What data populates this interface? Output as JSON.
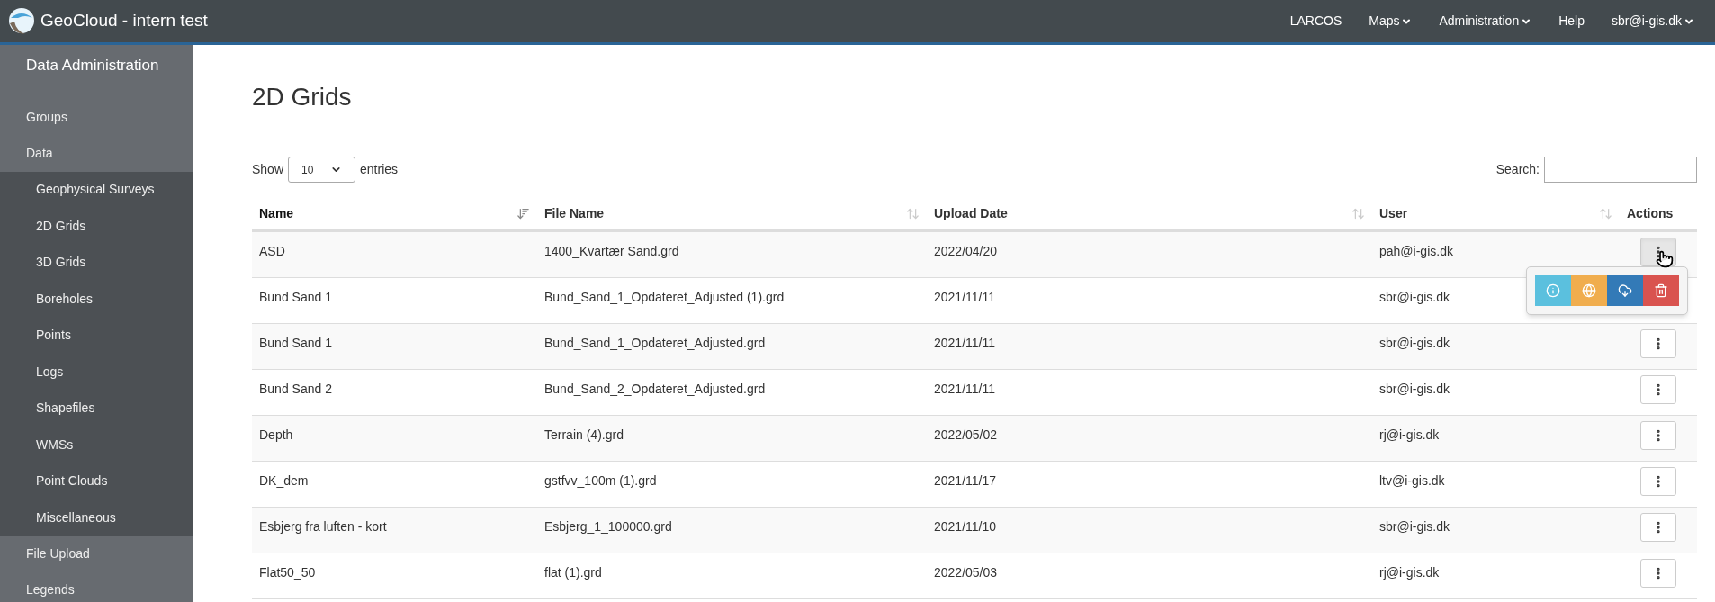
{
  "navbar": {
    "brand": "GeoCloud - intern test",
    "items": [
      {
        "label": "LARCOS",
        "dropdown": false
      },
      {
        "label": "Maps",
        "dropdown": true
      },
      {
        "label": "Administration",
        "dropdown": true
      },
      {
        "label": "Help",
        "dropdown": false
      },
      {
        "label": "sbr@i-gis.dk",
        "dropdown": true
      }
    ]
  },
  "sidebar": {
    "title": "Data Administration",
    "items": [
      {
        "label": "Groups"
      },
      {
        "label": "Data",
        "children": [
          {
            "label": "Geophysical Surveys"
          },
          {
            "label": "2D Grids"
          },
          {
            "label": "3D Grids"
          },
          {
            "label": "Boreholes"
          },
          {
            "label": "Points"
          },
          {
            "label": "Logs"
          },
          {
            "label": "Shapefiles"
          },
          {
            "label": "WMSs"
          },
          {
            "label": "Point Clouds"
          },
          {
            "label": "Miscellaneous"
          }
        ]
      },
      {
        "label": "File Upload"
      },
      {
        "label": "Legends"
      }
    ]
  },
  "page": {
    "title": "2D Grids"
  },
  "length_menu": {
    "before": "Show",
    "value": "10",
    "after": "entries"
  },
  "search": {
    "label": "Search:"
  },
  "table": {
    "columns": [
      {
        "label": "Name",
        "sorted": true
      },
      {
        "label": "File Name",
        "sorted": false
      },
      {
        "label": "Upload Date",
        "sorted": false
      },
      {
        "label": "User",
        "sorted": false
      },
      {
        "label": "Actions"
      }
    ],
    "rows": [
      {
        "cells": [
          "ASD",
          "1400_Kvartær Sand.grd",
          "2022/04/20",
          "pah@i-gis.dk"
        ],
        "menu_open": true
      },
      {
        "cells": [
          "Bund Sand 1",
          "Bund_Sand_1_Opdateret_Adjusted (1).grd",
          "2021/11/11",
          "sbr@i-gis.dk"
        ],
        "menu_open": false
      },
      {
        "cells": [
          "Bund Sand 1",
          "Bund_Sand_1_Opdateret_Adjusted.grd",
          "2021/11/11",
          "sbr@i-gis.dk"
        ],
        "menu_open": false
      },
      {
        "cells": [
          "Bund Sand 2",
          "Bund_Sand_2_Opdateret_Adjusted.grd",
          "2021/11/11",
          "sbr@i-gis.dk"
        ],
        "menu_open": false
      },
      {
        "cells": [
          "Depth",
          "Terrain (4).grd",
          "2022/05/02",
          "rj@i-gis.dk"
        ],
        "menu_open": false
      },
      {
        "cells": [
          "DK_dem",
          "gstfvv_100m (1).grd",
          "2021/11/17",
          "ltv@i-gis.dk"
        ],
        "menu_open": false
      },
      {
        "cells": [
          "Esbjerg fra luften - kort",
          "Esbjerg_1_100000.grd",
          "2021/11/10",
          "sbr@i-gis.dk"
        ],
        "menu_open": false
      },
      {
        "cells": [
          "Flat50_50",
          "flat (1).grd",
          "2022/05/03",
          "rj@i-gis.dk"
        ],
        "menu_open": false
      }
    ]
  },
  "action_menu": [
    {
      "kind": "info",
      "color": "#5bc0de"
    },
    {
      "kind": "globe",
      "color": "#f0ad4e"
    },
    {
      "kind": "download",
      "color": "#337ab7"
    },
    {
      "kind": "delete",
      "color": "#d9534f"
    }
  ]
}
